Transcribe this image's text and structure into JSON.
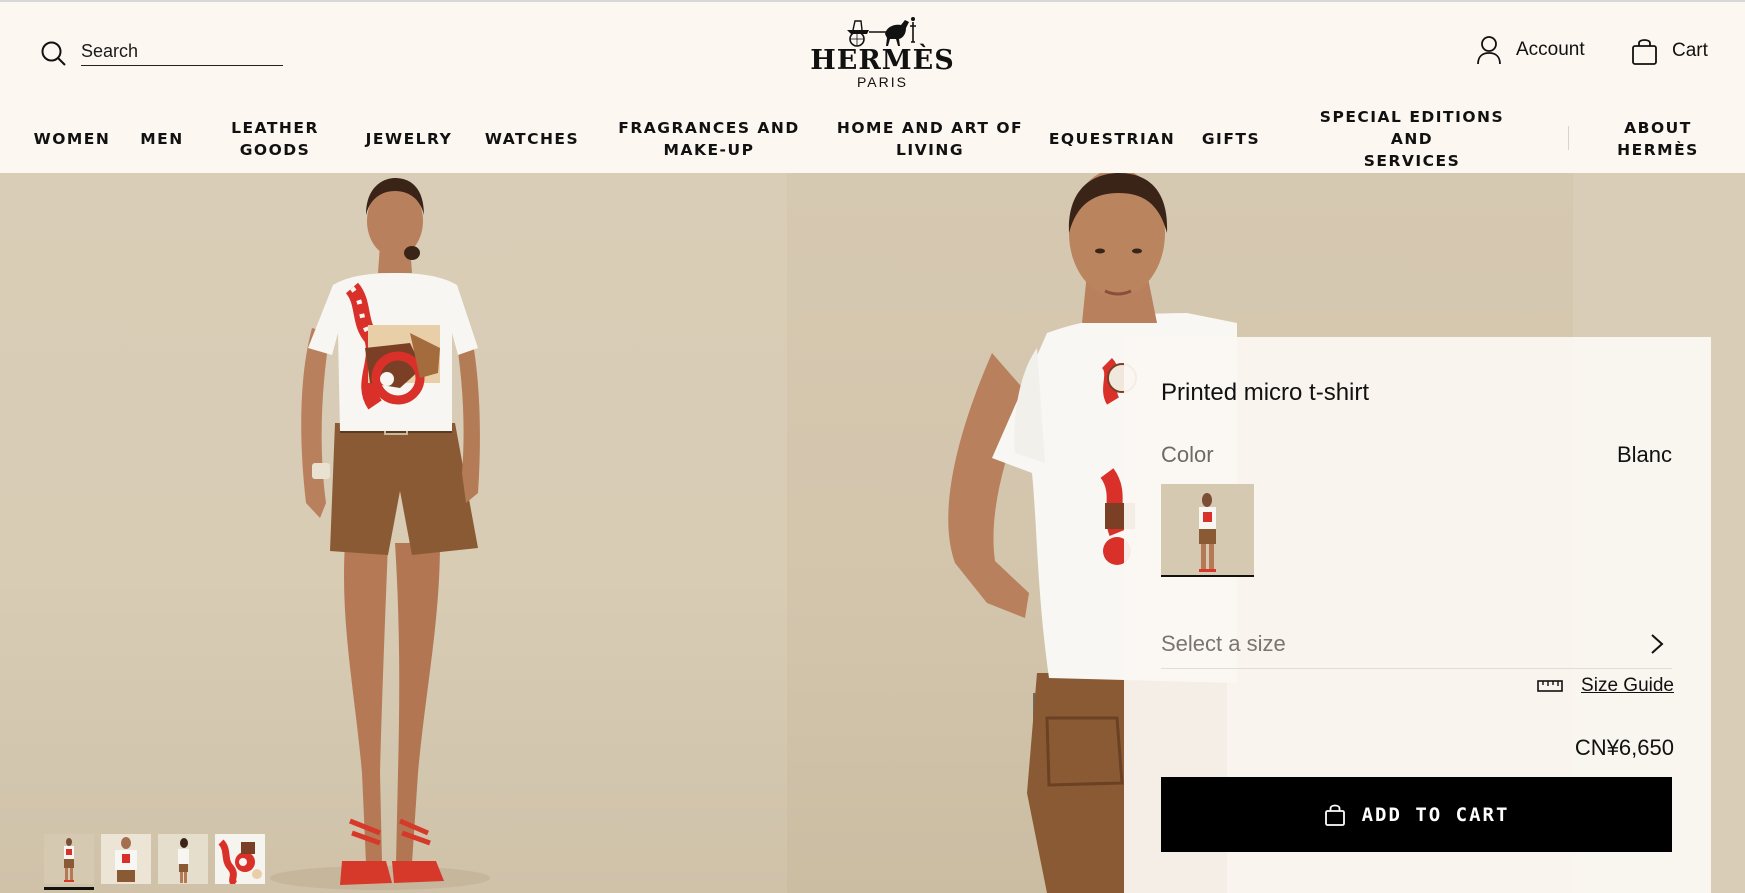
{
  "header": {
    "search_placeholder": "Search",
    "brand_name": "HERMÈS",
    "brand_city": "PARIS",
    "account_label": "Account",
    "cart_label": "Cart"
  },
  "nav": {
    "items": [
      {
        "line1": "WOMEN",
        "line2": ""
      },
      {
        "line1": "MEN",
        "line2": ""
      },
      {
        "line1": "LEATHER",
        "line2": "GOODS"
      },
      {
        "line1": "JEWELRY",
        "line2": ""
      },
      {
        "line1": "WATCHES",
        "line2": ""
      },
      {
        "line1": "FRAGRANCES AND",
        "line2": "MAKE-UP"
      },
      {
        "line1": "HOME AND ART OF",
        "line2": "LIVING"
      },
      {
        "line1": "EQUESTRIAN",
        "line2": ""
      },
      {
        "line1": "GIFTS",
        "line2": ""
      },
      {
        "line1": "SPECIAL EDITIONS AND",
        "line2": "SERVICES"
      },
      {
        "line1": "ABOUT",
        "line2": "HERMÈS"
      }
    ]
  },
  "gallery": {
    "thumbnail_count": 4,
    "active_thumbnail": 1
  },
  "product": {
    "title": "Printed micro t-shirt",
    "color_label": "Color",
    "color_value": "Blanc",
    "size_placeholder": "Select a size",
    "size_guide_label": "Size Guide",
    "price": "CN¥6,650",
    "add_to_cart_label": "ADD TO CART"
  },
  "colors": {
    "background": "#fcf7f0",
    "button": "#000000",
    "accent_red": "#d9302a",
    "shorts_brown": "#8a5a35"
  },
  "icons": [
    "search-icon",
    "hermes-carriage-logo",
    "account-icon",
    "cart-bag-icon",
    "chevron-right-icon",
    "ruler-icon",
    "shopping-bag-icon"
  ]
}
